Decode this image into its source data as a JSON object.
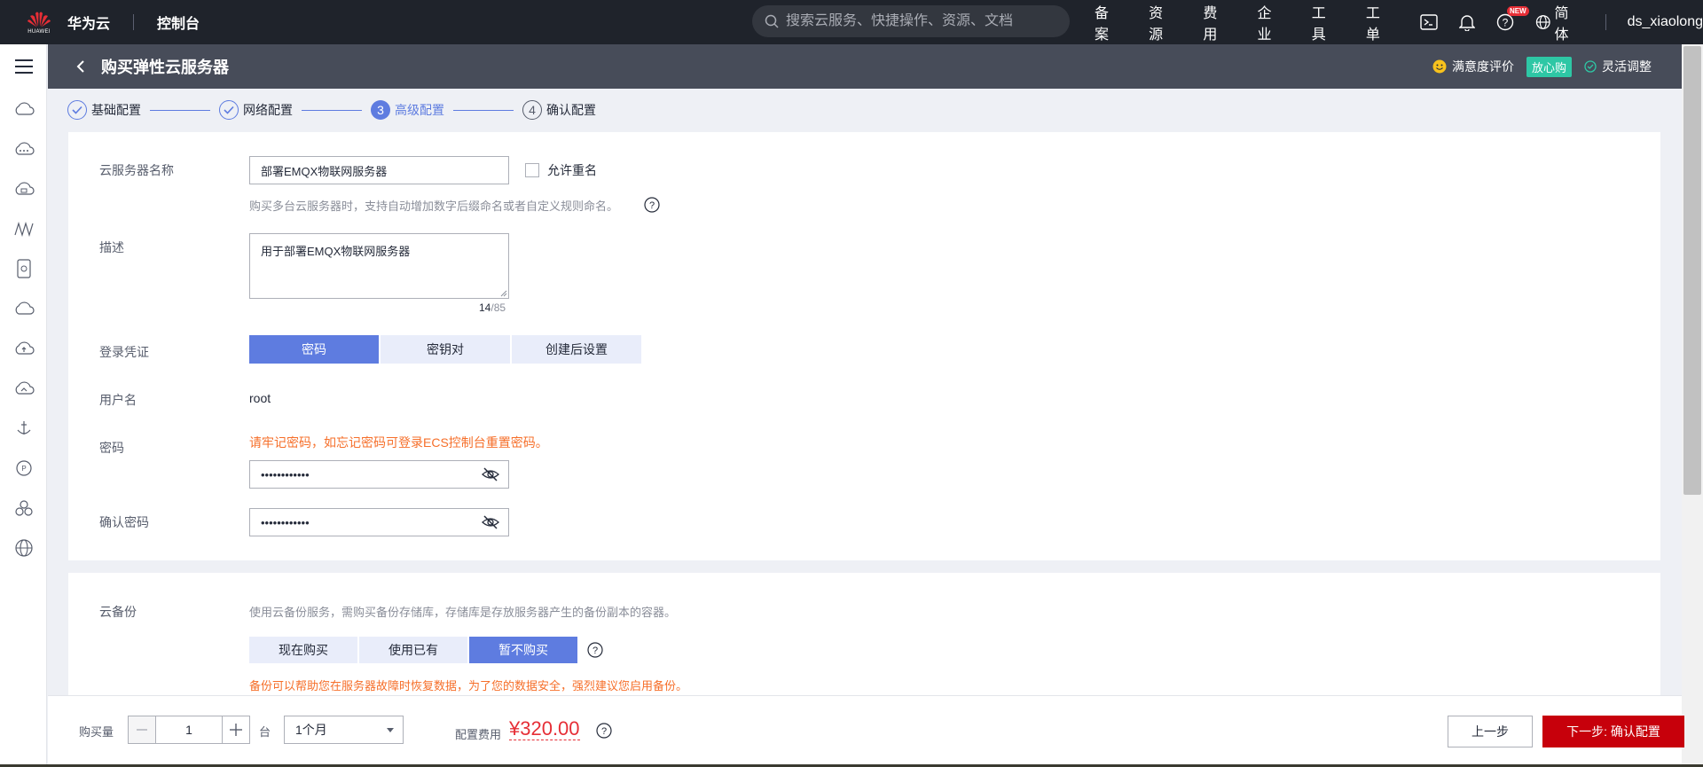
{
  "header": {
    "logo_text": "HUAWEI",
    "brand": "华为云",
    "console": "控制台",
    "search_placeholder": "搜索云服务、快捷操作、资源、文档",
    "nav": [
      "备案",
      "资源",
      "费用",
      "企业",
      "工具",
      "工单"
    ],
    "new_badge": "NEW",
    "language": "简体",
    "username": "ds_xiaolong"
  },
  "sidebar": {
    "icons": [
      "cloud-icon",
      "cloud-dots-icon",
      "cloud-db-icon",
      "network-icon",
      "storage-icon",
      "cloud-outline-icon",
      "cloud-upload-icon",
      "cloud-sync-icon",
      "anchor-icon",
      "chat-icon",
      "cluster-icon",
      "globe-icon"
    ]
  },
  "titlebar": {
    "title": "购买弹性云服务器",
    "satisfaction": "满意度评价",
    "tag": "放心购",
    "flexible": "灵活调整"
  },
  "steps": [
    {
      "num": "",
      "label": "基础配置",
      "state": "done"
    },
    {
      "num": "",
      "label": "网络配置",
      "state": "done"
    },
    {
      "num": "3",
      "label": "高级配置",
      "state": "active"
    },
    {
      "num": "4",
      "label": "确认配置",
      "state": "todo"
    }
  ],
  "form": {
    "name_label": "云服务器名称",
    "name_value": "部署EMQX物联网服务器",
    "allow_dup_label": "允许重名",
    "name_hint": "购买多台云服务器时，支持自动增加数字后缀命名或者自定义规则命名。",
    "desc_label": "描述",
    "desc_value": "用于部署EMQX物联网服务器",
    "desc_count": "14",
    "desc_max": "/85",
    "login_label": "登录凭证",
    "login_tabs": [
      "密码",
      "密钥对",
      "创建后设置"
    ],
    "user_label": "用户名",
    "user_value": "root",
    "password_label": "密码",
    "password_warning": "请牢记密码，如忘记密码可登录ECS控制台重置密码。",
    "password_value": "Emqx@2023abc",
    "confirm_label": "确认密码",
    "confirm_value": "Emqx@2023abc"
  },
  "backup": {
    "label": "云备份",
    "hint": "使用云备份服务，需购买备份存储库，存储库是存放服务器产生的备份副本的容器。",
    "tabs": [
      "现在购买",
      "使用已有",
      "暂不购买"
    ],
    "warning": "备份可以帮助您在服务器故障时恢复数据，为了您的数据安全，强烈建议您启用备份。"
  },
  "bottom": {
    "qty_label": "购买量",
    "qty_value": "1",
    "unit": "台",
    "duration": "1个月",
    "fee_label": "配置费用",
    "price": "¥320.00",
    "prev": "上一步",
    "next": "下一步: 确认配置"
  },
  "colors": {
    "primary": "#5e7ce0",
    "warning": "#f66f2a",
    "price": "#e62e36",
    "next_button": "#c7000b",
    "header_bg": "#1f232b"
  }
}
